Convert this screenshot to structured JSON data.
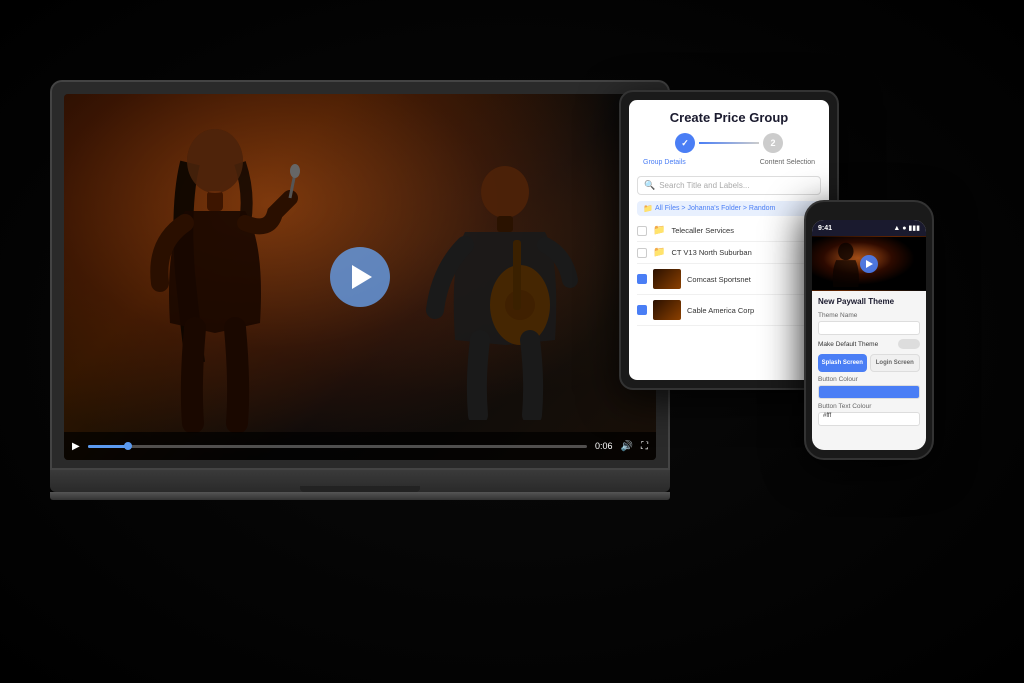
{
  "scene": {
    "background": "#000000"
  },
  "laptop": {
    "video": {
      "progress_time": "0:06",
      "progress_percent": 8
    }
  },
  "tablet": {
    "title": "Create Price Group",
    "steps": [
      {
        "label": "Group Details",
        "state": "active",
        "number": "1"
      },
      {
        "label": "Content Selection",
        "state": "inactive",
        "number": "2"
      }
    ],
    "search_placeholder": "Search Title and Labels...",
    "breadcrumb": "All Files > Johanna's Folder > Random",
    "files": [
      {
        "name": "Telecaller Services",
        "type": "folder",
        "checked": false
      },
      {
        "name": "CT V13 North Suburban",
        "type": "folder",
        "checked": false
      },
      {
        "name": "Comcast Sportsnet",
        "type": "video",
        "checked": true
      },
      {
        "name": "Cable America Corp",
        "type": "video",
        "checked": true
      }
    ]
  },
  "phone": {
    "status_time": "9:41",
    "section_title": "New Paywall Theme",
    "theme_name_label": "Theme Name",
    "default_toggle_label": "Make Default Theme",
    "tab_splash": "Splash Screen",
    "tab_login": "Login Screen",
    "button_colour_label": "Button Colour",
    "button_text_label": "Button Text Colour",
    "button_text_value": "#fff"
  }
}
